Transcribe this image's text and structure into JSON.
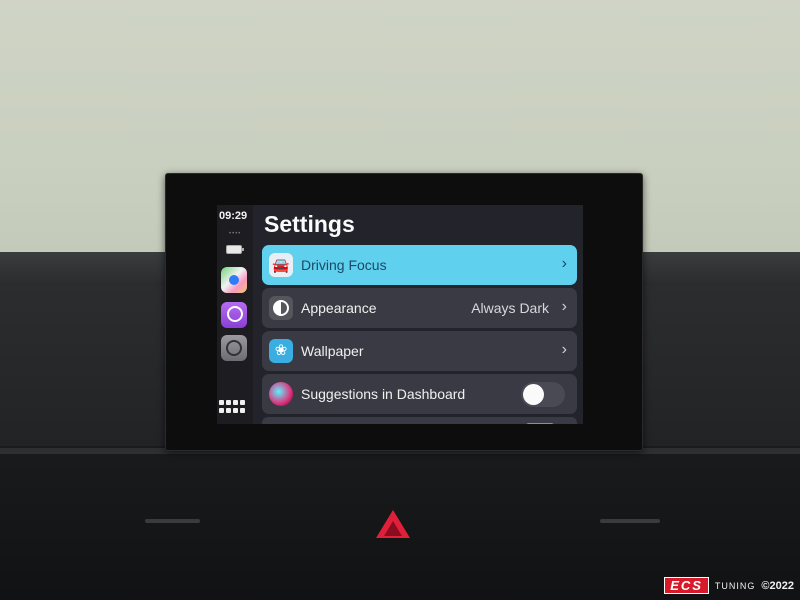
{
  "status": {
    "time": "09:29",
    "signal_dots": "••••"
  },
  "dock": {
    "apps": [
      {
        "name": "Maps",
        "icon": "maps-icon"
      },
      {
        "name": "Podcasts",
        "icon": "podcasts-icon"
      },
      {
        "name": "Settings",
        "icon": "settings-icon"
      }
    ],
    "home_icon": "app-grid-icon"
  },
  "settings": {
    "title": "Settings",
    "rows": [
      {
        "label": "Driving Focus",
        "value": "",
        "chevron": "›",
        "icon_glyph": "🚘",
        "selected": true
      },
      {
        "label": "Appearance",
        "value": "Always Dark",
        "chevron": "›",
        "selected": false
      },
      {
        "label": "Wallpaper",
        "value": "",
        "chevron": "›",
        "icon_glyph": "❀",
        "selected": false
      },
      {
        "label": "Suggestions in Dashboard",
        "toggle": false
      }
    ]
  },
  "colors": {
    "highlight": "#5fd0ee",
    "row_bg": "#3a3a44",
    "hazard": "#e0203a"
  },
  "watermark": {
    "logo": "ECS",
    "text": "TUNING",
    "copyright": "©2022"
  }
}
